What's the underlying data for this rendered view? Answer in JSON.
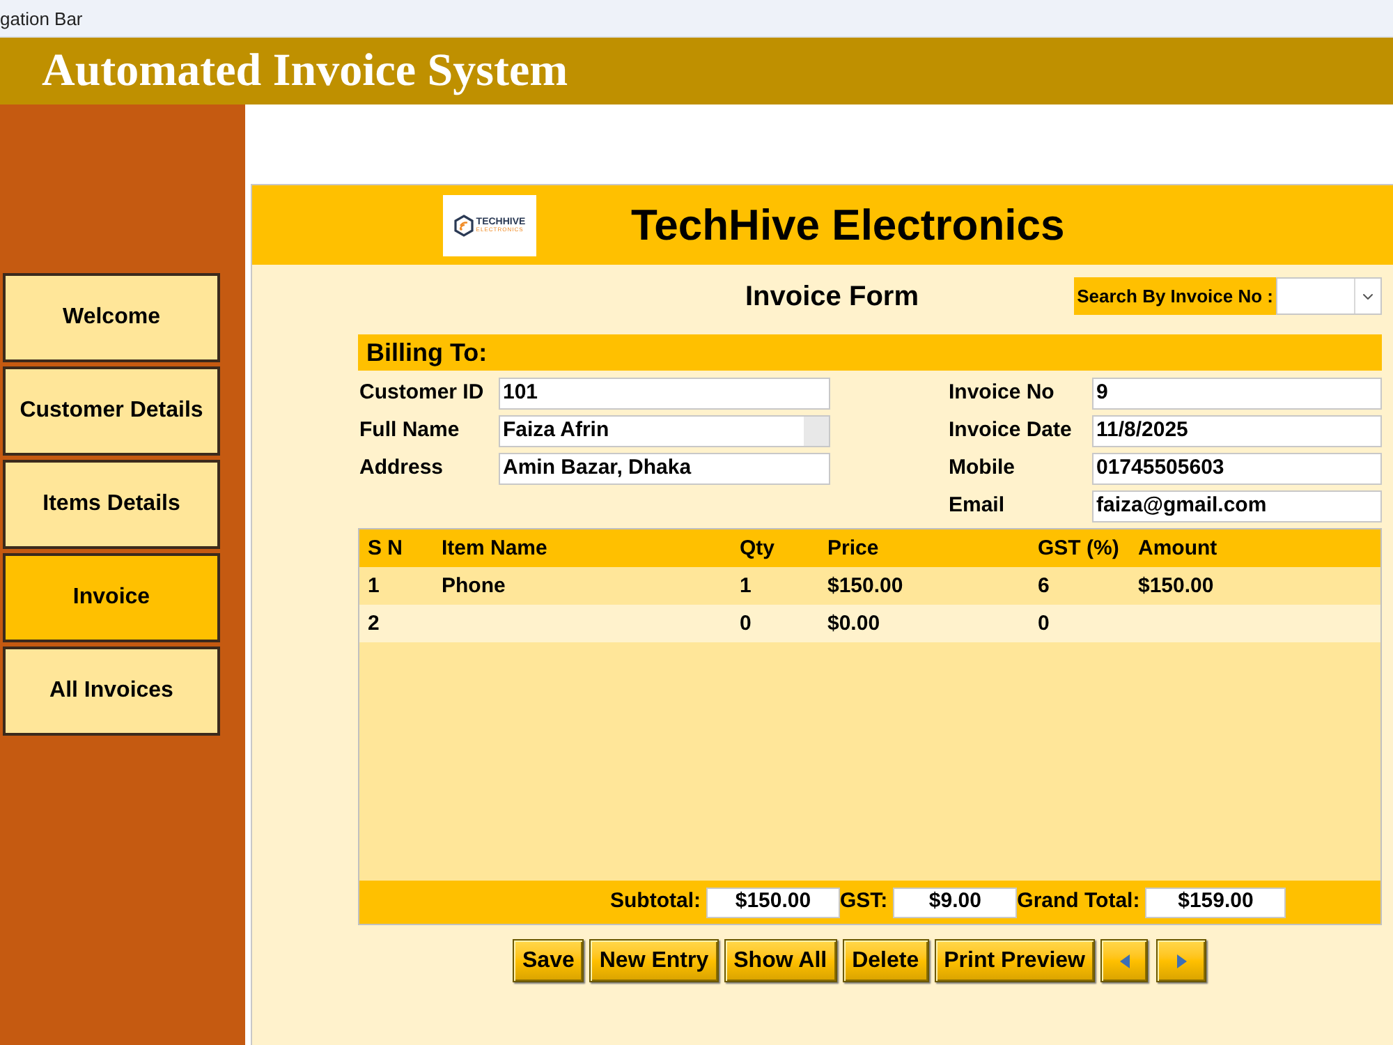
{
  "tab": {
    "title": "gation Bar"
  },
  "header": {
    "title": "Automated Invoice System"
  },
  "sidebar": {
    "items": [
      {
        "label": "Welcome",
        "selected": false
      },
      {
        "label": "Customer Details",
        "selected": false
      },
      {
        "label": "Items Details",
        "selected": false
      },
      {
        "label": "Invoice",
        "selected": true
      },
      {
        "label": "All Invoices",
        "selected": false
      }
    ]
  },
  "form": {
    "logo": {
      "name": "TECHHIVE",
      "tagline": "ELECTRONICS"
    },
    "company": "TechHive Electronics",
    "title": "Invoice Form",
    "search": {
      "label": "Search By Invoice No :"
    },
    "billing": {
      "heading": "Billing To:",
      "left_fields": [
        {
          "label": "Customer ID",
          "value": "101",
          "scrollbar": false
        },
        {
          "label": "Full Name",
          "value": "Faiza Afrin",
          "scrollbar": true
        },
        {
          "label": "Address",
          "value": "Amin Bazar, Dhaka",
          "scrollbar": false
        }
      ],
      "right_fields": [
        {
          "label": "Invoice No",
          "value": "9"
        },
        {
          "label": "Invoice Date",
          "value": "11/8/2025"
        },
        {
          "label": "Mobile",
          "value": "01745505603"
        },
        {
          "label": "Email",
          "value": "faiza@gmail.com"
        }
      ]
    },
    "items_table": {
      "columns": [
        "S N",
        "Item Name",
        "Qty",
        "Price",
        "GST (%)",
        "Amount"
      ],
      "rows": [
        [
          "1",
          "Phone",
          "1",
          "$150.00",
          "6",
          "$150.00"
        ],
        [
          "2",
          null,
          "0",
          "$0.00",
          "0",
          null
        ]
      ]
    },
    "totals": [
      {
        "label": "Subtotal:",
        "value": "$150.00"
      },
      {
        "label": "GST:",
        "value": "$9.00"
      },
      {
        "label": "Grand Total:",
        "value": "$159.00"
      }
    ],
    "buttons": [
      {
        "kind": "text",
        "label": "Save"
      },
      {
        "kind": "text",
        "label": "New Entry"
      },
      {
        "kind": "text",
        "label": "Show All"
      },
      {
        "kind": "text",
        "label": "Delete"
      },
      {
        "kind": "text",
        "label": "Print Preview"
      },
      {
        "kind": "arrow_left"
      },
      {
        "kind": "arrow_right"
      }
    ]
  }
}
